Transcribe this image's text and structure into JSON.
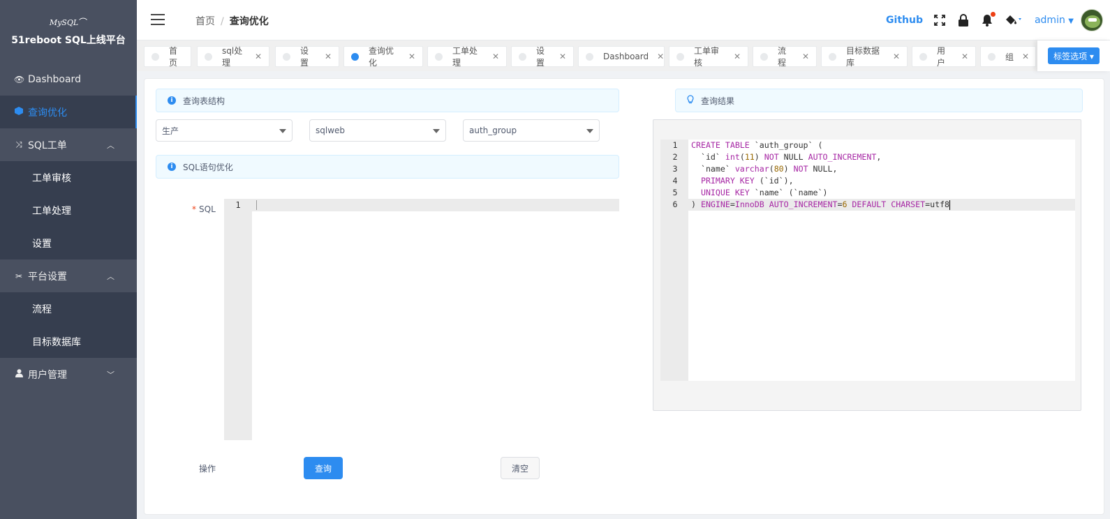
{
  "app": {
    "logo_text": "MySQL",
    "title": "51reboot SQL上线平台"
  },
  "sidebar": {
    "items": [
      {
        "label": "Dashboard",
        "icon": "eye-icon"
      },
      {
        "label": "查询优化",
        "icon": "cube-icon",
        "active": true
      },
      {
        "label": "SQL工单",
        "icon": "shuffle-icon",
        "expanded": true,
        "children": [
          {
            "label": "工单审核"
          },
          {
            "label": "工单处理"
          },
          {
            "label": "设置"
          }
        ]
      },
      {
        "label": "平台设置",
        "icon": "tools-icon",
        "expanded": true,
        "children": [
          {
            "label": "流程"
          },
          {
            "label": "目标数据库"
          }
        ]
      },
      {
        "label": "用户管理",
        "icon": "person-icon",
        "expanded": false
      }
    ]
  },
  "header": {
    "breadcrumb": [
      "首页",
      "查询优化"
    ],
    "github_label": "Github",
    "user_name": "admin"
  },
  "tabs": {
    "items": [
      {
        "label": "首页",
        "closable": false
      },
      {
        "label": "sql处理",
        "closable": true
      },
      {
        "label": "设置",
        "closable": true
      },
      {
        "label": "查询优化",
        "closable": true,
        "active": true
      },
      {
        "label": "工单处理",
        "closable": true
      },
      {
        "label": "设置",
        "closable": true
      },
      {
        "label": "Dashboard",
        "closable": true
      },
      {
        "label": "工单审核",
        "closable": true
      },
      {
        "label": "流程",
        "closable": true
      },
      {
        "label": "目标数据库",
        "closable": true
      },
      {
        "label": "用户",
        "closable": true
      },
      {
        "label": "组",
        "closable": true
      }
    ],
    "options_label": "标签选项"
  },
  "main": {
    "table_section_title": "查询表结构",
    "selects": {
      "env": "生产",
      "database": "sqlweb",
      "table": "auth_group"
    },
    "sql_section_title": "SQL语句优化",
    "sql_label": "SQL",
    "sql_line_number": "1",
    "op_label": "操作",
    "query_button": "查询",
    "clear_button": "清空",
    "result_title": "查询结果",
    "result_lines": [
      "CREATE TABLE `auth_group` (",
      "  `id` int(11) NOT NULL AUTO_INCREMENT,",
      "  `name` varchar(80) NOT NULL,",
      "  PRIMARY KEY (`id`),",
      "  UNIQUE KEY `name` (`name`)",
      ") ENGINE=InnoDB AUTO_INCREMENT=6 DEFAULT CHARSET=utf8"
    ]
  },
  "colors": {
    "accent": "#2d8cf0",
    "sidebar": "#495060",
    "sidebar_dark": "#363e4f",
    "notify_dot": "#ed4014"
  }
}
